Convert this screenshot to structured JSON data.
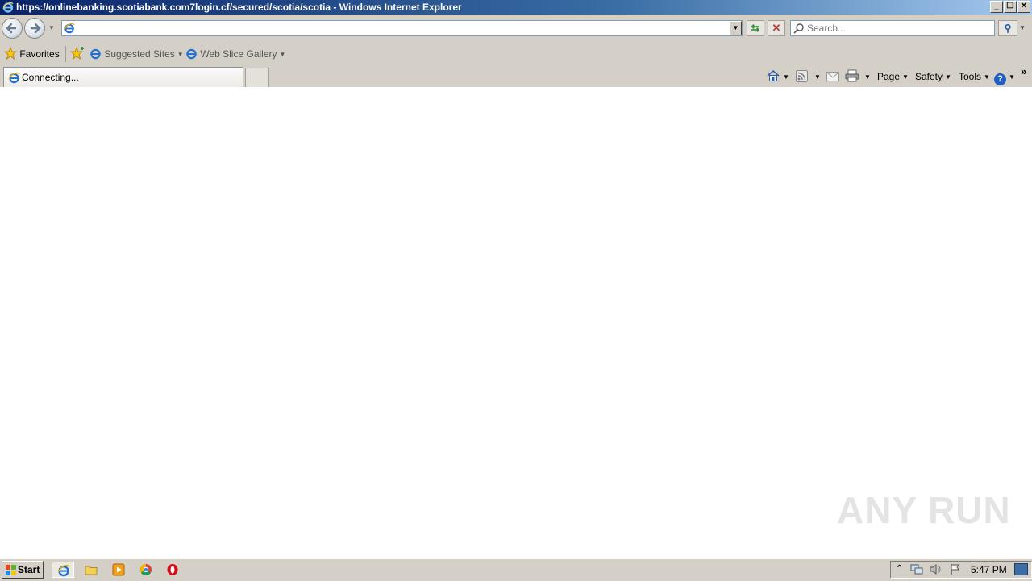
{
  "window": {
    "title": "https://onlinebanking.scotiabank.com7login.cf/secured/scotia/scotia - Windows Internet Explorer",
    "controls": {
      "minimize": "_",
      "restore": "❐",
      "close": "✕"
    }
  },
  "nav": {
    "address_value": "",
    "search_placeholder": "Search...",
    "refresh_glyph": "⇆",
    "stop_glyph": "✕",
    "search_go_glyph": "⚲",
    "dropdown_glyph": "▼"
  },
  "favorites_bar": {
    "favorites_label": "Favorites",
    "items": [
      {
        "label": "Suggested Sites"
      },
      {
        "label": "Web Slice Gallery"
      }
    ]
  },
  "tabs": [
    {
      "label": "Connecting..."
    }
  ],
  "command_bar": {
    "page_label": "Page",
    "safety_label": "Safety",
    "tools_label": "Tools",
    "help_glyph": "?",
    "more_glyph": "»"
  },
  "watermark": {
    "text": "ANY RUN"
  },
  "taskbar": {
    "start_label": "Start",
    "clock": "5:47 PM",
    "icons": [
      "internet-explorer-icon",
      "folder-icon",
      "media-player-icon",
      "chrome-icon",
      "opera-icon"
    ]
  },
  "colors": {
    "title_gradient_start": "#0a246a",
    "title_gradient_end": "#a6caf0",
    "chrome_face": "#d4d0c8",
    "content_bg": "#ffffff"
  }
}
